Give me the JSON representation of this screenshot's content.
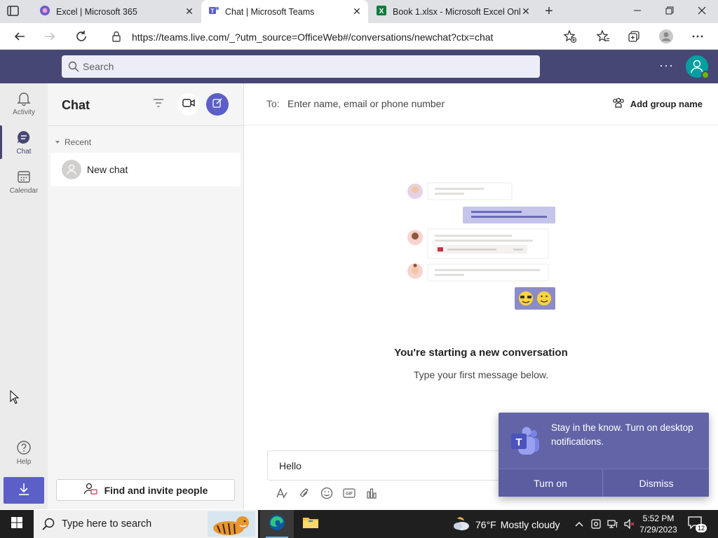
{
  "browser": {
    "tabs": [
      {
        "title": "Excel | Microsoft 365",
        "active": false
      },
      {
        "title": "Chat | Microsoft Teams",
        "active": true
      },
      {
        "title": "Book 1.xlsx - Microsoft Excel Onl",
        "active": false
      }
    ],
    "url": "https://teams.live.com/_?utm_source=OfficeWeb#/conversations/newchat?ctx=chat"
  },
  "header": {
    "search_placeholder": "Search",
    "more_label": "···"
  },
  "rail": {
    "items": [
      {
        "label": "Activity",
        "icon": "bell-icon"
      },
      {
        "label": "Chat",
        "icon": "chat-icon",
        "active": true
      },
      {
        "label": "Calendar",
        "icon": "calendar-icon"
      },
      {
        "label": "Help",
        "icon": "help-icon"
      }
    ]
  },
  "chat_pane": {
    "title": "Chat",
    "section_label": "Recent",
    "new_chat_label": "New chat",
    "invite_label": "Find and invite people"
  },
  "conversation": {
    "to_label": "To:",
    "to_placeholder": "Enter name, email or phone number",
    "add_group_label": "Add group name",
    "empty_title": "You're starting a new conversation",
    "empty_subtitle": "Type your first message below.",
    "composer_text": "Hello"
  },
  "toast": {
    "message": "Stay in the know. Turn on desktop notifications.",
    "turn_on_label": "Turn on",
    "dismiss_label": "Dismiss"
  },
  "taskbar": {
    "search_placeholder": "Type here to search",
    "weather_temp": "76°F",
    "weather_condition": "Mostly cloudy",
    "time": "5:52 PM",
    "date": "7/29/2023",
    "notification_count": "12"
  },
  "colors": {
    "teams_header": "#464775",
    "teams_accent": "#5b5fc7",
    "toast_bg": "#6264a7"
  }
}
